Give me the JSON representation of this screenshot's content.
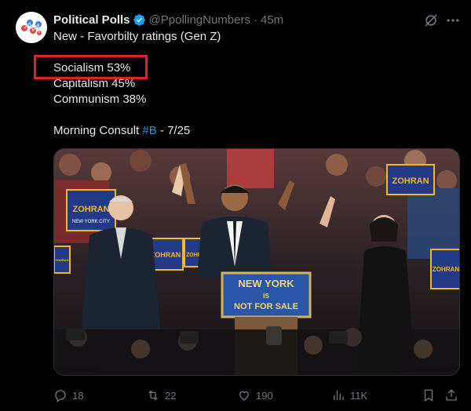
{
  "author": {
    "display_name": "Political Polls",
    "handle": "@PpollingNumbers",
    "separator": "·",
    "time": "45m"
  },
  "tweet": {
    "line1": "New - Favorbilty ratings (Gen Z)",
    "line2": "Socialism 53%",
    "line3": "Capitalism 45%",
    "line4": "Communism 38%",
    "source_prefix": "Morning Consult ",
    "hashtag": "#B",
    "source_suffix": " - 7/25"
  },
  "photo": {
    "podium_line1": "NEW YORK",
    "podium_line2": "IS",
    "podium_line3": "NOT FOR SALE",
    "signs": [
      "ZOHRAN",
      "ZOHRAN",
      "ZOHRAN",
      "ZOHRAN",
      "ZOHRAN",
      "ZOHRAN"
    ],
    "sign_sub": "NEW YORK CITY"
  },
  "actions": {
    "replies": "18",
    "reposts": "22",
    "likes": "190",
    "views": "11K"
  },
  "colors": {
    "background": "#000000",
    "text": "#e7e9ea",
    "muted": "#71767b",
    "link": "#1d9bf0",
    "highlight": "#e0202a"
  }
}
